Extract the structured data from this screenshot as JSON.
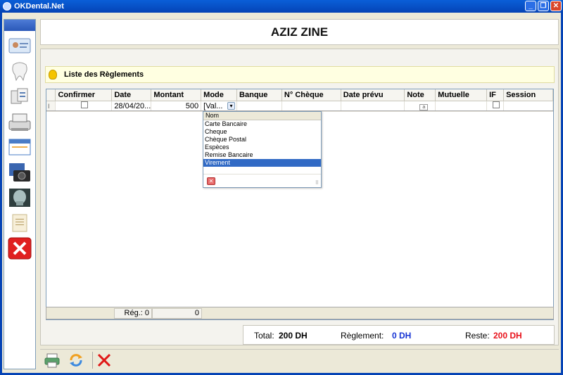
{
  "window": {
    "title": "OKDental.Net"
  },
  "header": {
    "patient_name": "AZIZ ZINE"
  },
  "notice": {
    "text": "Liste des Règlements"
  },
  "grid": {
    "columns": [
      "Confirmer",
      "Date",
      "Montant",
      "Mode",
      "Banque",
      "N° Chèque",
      "Date prévu",
      "Note",
      "Mutuelle",
      "IF",
      "Session"
    ],
    "row": {
      "row_marker": "I",
      "date": "28/04/20...",
      "montant": "500",
      "mode": "[Val..."
    }
  },
  "mode_dropdown": {
    "header": "Nom",
    "options": [
      "Carte Bancaire",
      "Cheque",
      "Chèque Postal",
      "Espèces",
      "Remise Bancaire",
      "Virement"
    ],
    "selected": "Virement"
  },
  "footer_row": {
    "reg_label": "Rég.: 0",
    "reg_total": "0"
  },
  "totals": {
    "total_label": "Total:",
    "total_value": "200 DH",
    "reglement_label": "Règlement:",
    "reglement_value": "0 DH",
    "reste_label": "Reste:",
    "reste_value": "200 DH"
  },
  "colors": {
    "reglement": "#1533d4",
    "reste": "#e8121b",
    "selection": "#316ac5"
  },
  "icons": {
    "sidebar": [
      "patient-card-icon",
      "tooth-icon",
      "documents-icon",
      "cash-register-icon",
      "window-icon",
      "camera-icon",
      "xray-icon",
      "notepad-icon",
      "close-icon"
    ],
    "toolbar": [
      "printer-icon",
      "refresh-icon",
      "delete-icon"
    ]
  }
}
